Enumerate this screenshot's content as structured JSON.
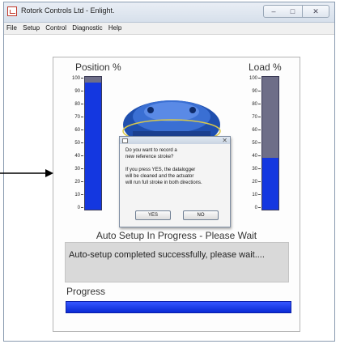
{
  "window": {
    "title": "Rotork Controls Ltd - Enlight.",
    "minimize_glyph": "–",
    "maximize_glyph": "□",
    "close_glyph": "✕"
  },
  "menu": [
    "File",
    "Setup",
    "Control",
    "Diagnostic",
    "Help"
  ],
  "position_gauge": {
    "title": "Position %",
    "ticks": [
      "100",
      "90",
      "80",
      "70",
      "60",
      "50",
      "40",
      "30",
      "20",
      "10",
      "0"
    ],
    "value_percent": 96,
    "fill_color": "#1437e0",
    "empty_color": "#6e6e88"
  },
  "load_gauge": {
    "title": "Load %",
    "ticks": [
      "100",
      "90",
      "80",
      "70",
      "60",
      "50",
      "40",
      "30",
      "20",
      "10",
      "0"
    ],
    "value_percent": 39,
    "fill_color": "#1437e0",
    "empty_color": "#6e6e88"
  },
  "dialog": {
    "close_glyph": "✕",
    "lines": [
      "Do you want to record a",
      "new reference stroke?",
      "",
      "If you press YES, the datalogger",
      "will be cleaned and the actuator",
      "will run full stroke in both directions."
    ],
    "yes_label": "YES",
    "no_label": "NO"
  },
  "status": {
    "heading": "Auto Setup In Progress - Please Wait",
    "message": "Auto-setup completed successfully, please wait...."
  },
  "progress": {
    "label": "Progress",
    "value_percent": 100,
    "color": "#0a2ad4"
  },
  "annotation": {
    "arrow_color": "#000000"
  }
}
